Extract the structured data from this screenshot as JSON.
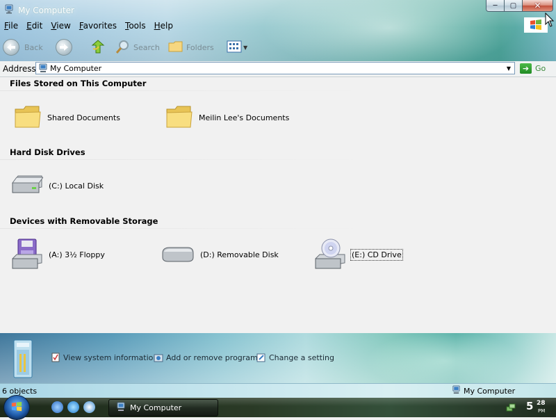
{
  "window": {
    "title": "My Computer",
    "buttons": {
      "minimize": "─",
      "maximize": "▢",
      "close": "✕"
    }
  },
  "menu": [
    "File",
    "Edit",
    "View",
    "Favorites",
    "Tools",
    "Help"
  ],
  "toolbar": {
    "back": "Back",
    "search": "Search",
    "folders": "Folders"
  },
  "address": {
    "label": "Address",
    "value": "My Computer",
    "go": "Go"
  },
  "groups": [
    {
      "title": "Files Stored on This Computer",
      "items": [
        {
          "label": "Shared Documents",
          "icon": "folder-icon"
        },
        {
          "label": "Meilin Lee's Documents",
          "icon": "folder-icon"
        }
      ]
    },
    {
      "title": "Hard Disk Drives",
      "items": [
        {
          "label": "(C:) Local Disk",
          "icon": "hard-disk-icon"
        }
      ]
    },
    {
      "title": "Devices with Removable Storage",
      "items": [
        {
          "label": "(A:) 3½ Floppy",
          "icon": "floppy-drive-icon"
        },
        {
          "label": "(D:) Removable Disk",
          "icon": "removable-disk-icon"
        },
        {
          "label": "(E:) CD Drive",
          "icon": "cd-drive-icon",
          "selected": true
        }
      ]
    }
  ],
  "tasks": [
    {
      "label": "View system information",
      "icon": "system-info-icon"
    },
    {
      "label": "Add or remove programs",
      "icon": "programs-icon"
    },
    {
      "label": "Change a setting",
      "icon": "settings-icon"
    }
  ],
  "status": {
    "left": "6 objects",
    "right": "My Computer"
  },
  "taskbar": {
    "window_label": "My Computer",
    "clock_hour": "5",
    "clock_min": "28",
    "clock_ampm": "PM"
  }
}
